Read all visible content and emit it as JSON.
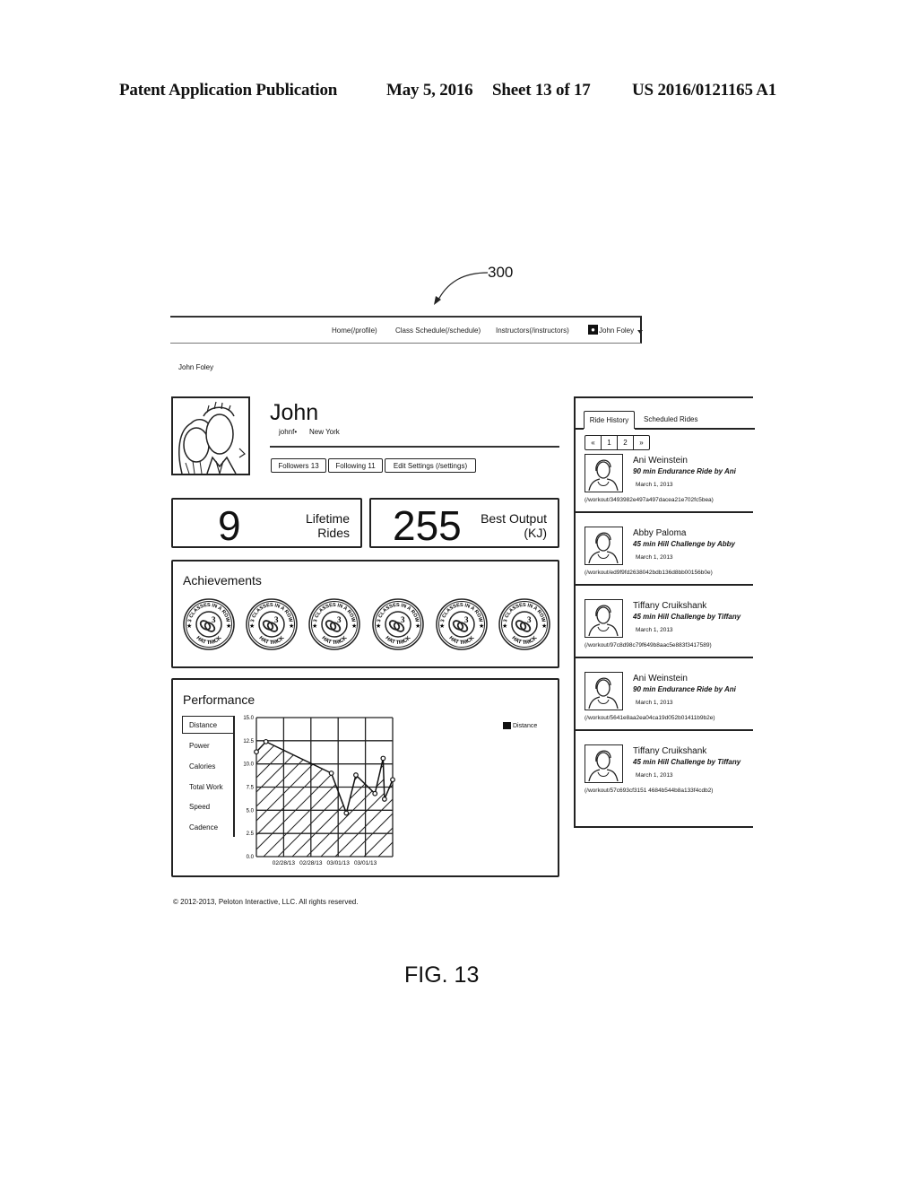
{
  "patent_header": {
    "left": "Patent Application Publication",
    "date": "May 5, 2016",
    "sheet": "Sheet 13 of 17",
    "number": "US 2016/0121165 A1"
  },
  "reference_numeral": "300",
  "figure_label": "FIG. 13",
  "navbar": {
    "links": [
      "Home(/profile)",
      "Class Schedule(/schedule)",
      "Instructors(/instructors)"
    ],
    "user_label": "John Foley"
  },
  "breadcrumb": "John Foley",
  "profile": {
    "name": "John",
    "handle": "johnf•",
    "location": "New York",
    "buttons": [
      "Followers 13",
      "Following 11",
      "Edit Settings (/settings)"
    ]
  },
  "stats": [
    {
      "value": "9",
      "label_line1": "Lifetime",
      "label_line2": "Rides"
    },
    {
      "value": "255",
      "label_line1": "Best Output",
      "label_line2": "(KJ)"
    }
  ],
  "achievements": {
    "title": "Achievements",
    "badges": [
      {
        "top_text": "3 CLASSES IN A ROW",
        "bottom_text": "HAT TRICK"
      },
      {
        "top_text": "3 CLASSES IN A ROW",
        "bottom_text": "HAT TRICK"
      },
      {
        "top_text": "3 CLASSES IN A ROW",
        "bottom_text": "HAT TRICK"
      },
      {
        "top_text": "3 CLASSES IN A ROW",
        "bottom_text": "HAT TRICK"
      },
      {
        "top_text": "3 CLASSES IN A ROW",
        "bottom_text": "HAT TRICK"
      },
      {
        "top_text": "3 CLASSES IN A ROW",
        "bottom_text": "HAT TRICK"
      }
    ]
  },
  "performance": {
    "title": "Performance",
    "metrics": [
      "Distance",
      "Power",
      "Calories",
      "Total Work",
      "Speed",
      "Cadence"
    ],
    "selected_metric": "Distance",
    "legend": "Distance"
  },
  "chart_data": {
    "type": "area",
    "title": "",
    "xlabel": "",
    "ylabel": "",
    "ylim": [
      0,
      15
    ],
    "yticks": [
      "0.0",
      "2.5",
      "5.0",
      "7.5",
      "10.0",
      "12.5",
      "15.0"
    ],
    "xtick_labels": [
      "02/28/13",
      "02/28/13",
      "03/01/13",
      "03/01/13"
    ],
    "grid": true,
    "legend": "top-right",
    "series": [
      {
        "name": "Distance",
        "x": [
          0.0,
          0.07,
          0.55,
          0.66,
          0.73,
          0.87,
          0.93,
          0.94,
          1.0
        ],
        "values": [
          11.3,
          12.4,
          9.0,
          4.7,
          8.8,
          6.8,
          10.6,
          6.2,
          8.3
        ]
      }
    ]
  },
  "ride_panel": {
    "tabs": [
      "Ride History",
      "Scheduled Rides"
    ],
    "pager": [
      "«",
      "1",
      "2",
      "»"
    ],
    "rides": [
      {
        "instructor": "Ani Weinstein",
        "title": "90 min Endurance Ride by Ani",
        "date": "March 1, 2013",
        "link": "(/workout/3493982e497a497dacea21e702fc5bea)"
      },
      {
        "instructor": "Abby Paloma",
        "title": "45 min Hill Challenge by Abby",
        "date": "March 1, 2013",
        "link": "(/workout/ed9f9fd2638042bdb136d8bb00156b0e)"
      },
      {
        "instructor": "Tiffany Cruikshank",
        "title": "45 min Hill Challenge by Tiffany",
        "date": "March 1, 2013",
        "link": "(/workout/97c8d98c79f649b8aac5e883f3417589)"
      },
      {
        "instructor": "Ani Weinstein",
        "title": "90 min Endurance Ride by Ani",
        "date": "March 1, 2013",
        "link": "(/workout/5641e8aa2ea04ca19d052b01411b9b2e)"
      },
      {
        "instructor": "Tiffany Cruikshank",
        "title": "45 min Hill Challenge by Tiffany",
        "date": "March 1, 2013",
        "link": "(/workout/57c693cf3151 4684b544b8a133f4cdb2)"
      }
    ]
  },
  "copyright": "© 2012-2013, Peloton Interactive, LLC. All rights reserved."
}
